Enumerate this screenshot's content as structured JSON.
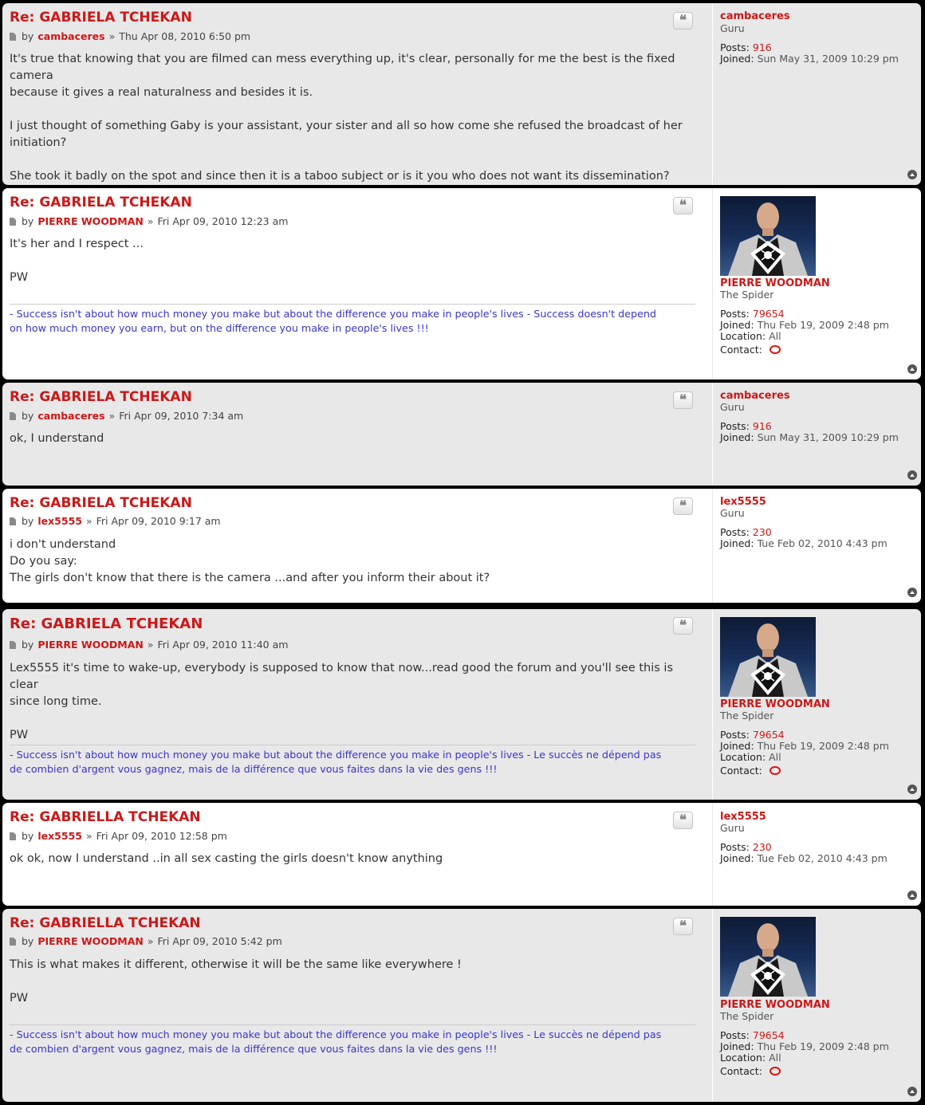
{
  "labels": {
    "by": "by",
    "sep": "»",
    "posts": "Posts:",
    "joined": "Joined:",
    "location": "Location:",
    "contact": "Contact:"
  },
  "posts": [
    {
      "title": "Re: GABRIELA TCHEKAN",
      "author": "cambaceres",
      "date": "Thu Apr 08, 2010 6:50 pm",
      "content": [
        "It's true that knowing that you are filmed can mess everything up, it's clear, personally for me the best is the fixed camera",
        "because it gives a real naturalness and besides it is.",
        "",
        "I just thought of something Gaby is your assistant, your sister and all so how come she refused the broadcast of her",
        "initiation?",
        "",
        "She took it badly on the spot and since then it is a taboo subject or is it you who does not want its dissemination?"
      ],
      "profile": {
        "name": "cambaceres",
        "rank": "Guru",
        "posts": "916",
        "joined": "Sun May 31, 2009 10:29 pm"
      }
    },
    {
      "title": "Re: GABRIELA TCHEKAN",
      "author": "PIERRE WOODMAN",
      "date": "Fri Apr 09, 2010 12:23 am",
      "content": [
        "It's her and I respect ...",
        "",
        "PW"
      ],
      "signature": [
        "- Success isn't about how much money you make but about the difference you make in people's lives - Success doesn't depend",
        "on how much money you earn, but on the difference you make in people's lives !!!"
      ],
      "profile": {
        "name": "PIERRE WOODMAN",
        "rank": "The Spider",
        "posts": "79654",
        "joined": "Thu Feb 19, 2009 2:48 pm",
        "location": "All"
      }
    },
    {
      "title": "Re: GABRIELA TCHEKAN",
      "author": "cambaceres",
      "date": "Fri Apr 09, 2010 7:34 am",
      "content": [
        "ok, I understand"
      ],
      "profile": {
        "name": "cambaceres",
        "rank": "Guru",
        "posts": "916",
        "joined": "Sun May 31, 2009 10:29 pm"
      }
    },
    {
      "title": "Re: GABRIELA TCHEKAN",
      "author": "lex5555",
      "date": "Fri Apr 09, 2010 9:17 am",
      "content": [
        "i don't understand",
        "Do you say:",
        "The girls don't know that there is the camera ...and after you inform their about it?"
      ],
      "profile": {
        "name": "lex5555",
        "rank": "Guru",
        "posts": "230",
        "joined": "Tue Feb 02, 2010 4:43 pm"
      }
    },
    {
      "title": "Re: GABRIELA TCHEKAN",
      "author": "PIERRE WOODMAN",
      "date": "Fri Apr 09, 2010 11:40 am",
      "content": [
        "Lex5555 it's time to wake-up, everybody is supposed to know that now...read good the forum and you'll see this is clear",
        "since long time.",
        "",
        "PW"
      ],
      "signature": [
        "- Success isn't about how much money you make but about the difference you make in people's lives - Le succès ne dépend pas",
        "de combien d'argent vous gagnez, mais de la différence que vous faites dans la vie des gens !!!"
      ],
      "profile": {
        "name": "PIERRE WOODMAN",
        "rank": "The Spider",
        "posts": "79654",
        "joined": "Thu Feb 19, 2009 2:48 pm",
        "location": "All"
      }
    },
    {
      "title": "Re: GABRIELLA TCHEKAN",
      "author": "lex5555",
      "date": "Fri Apr 09, 2010 12:58 pm",
      "content": [
        "ok ok, now I understand ..in all sex casting the girls doesn't know anything"
      ],
      "profile": {
        "name": "lex5555",
        "rank": "Guru",
        "posts": "230",
        "joined": "Tue Feb 02, 2010 4:43 pm"
      }
    },
    {
      "title": "Re: GABRIELLA TCHEKAN",
      "author": "PIERRE WOODMAN",
      "date": "Fri Apr 09, 2010 5:42 pm",
      "content": [
        "This is what makes it different, otherwise it will be the same like everywhere !",
        "",
        "PW"
      ],
      "signature": [
        "- Success isn't about how much money you make but about the difference you make in people's lives - Le succès ne dépend pas",
        "de combien d'argent vous gagnez, mais de la différence que vous faites dans la vie des gens !!!"
      ],
      "profile": {
        "name": "PIERRE WOODMAN",
        "rank": "The Spider",
        "posts": "79654",
        "joined": "Thu Feb 19, 2009 2:48 pm",
        "location": "All"
      }
    }
  ],
  "icons": {
    "quote": "quote-icon",
    "post": "post-document-icon",
    "contact": "speech-bubble-icon",
    "top": "back-to-top-icon"
  },
  "colors": {
    "title_red": "#cc1818",
    "signature_blue": "#3a34c8",
    "bg_light": "#e8e8e8",
    "bg_white": "#ffffff"
  }
}
